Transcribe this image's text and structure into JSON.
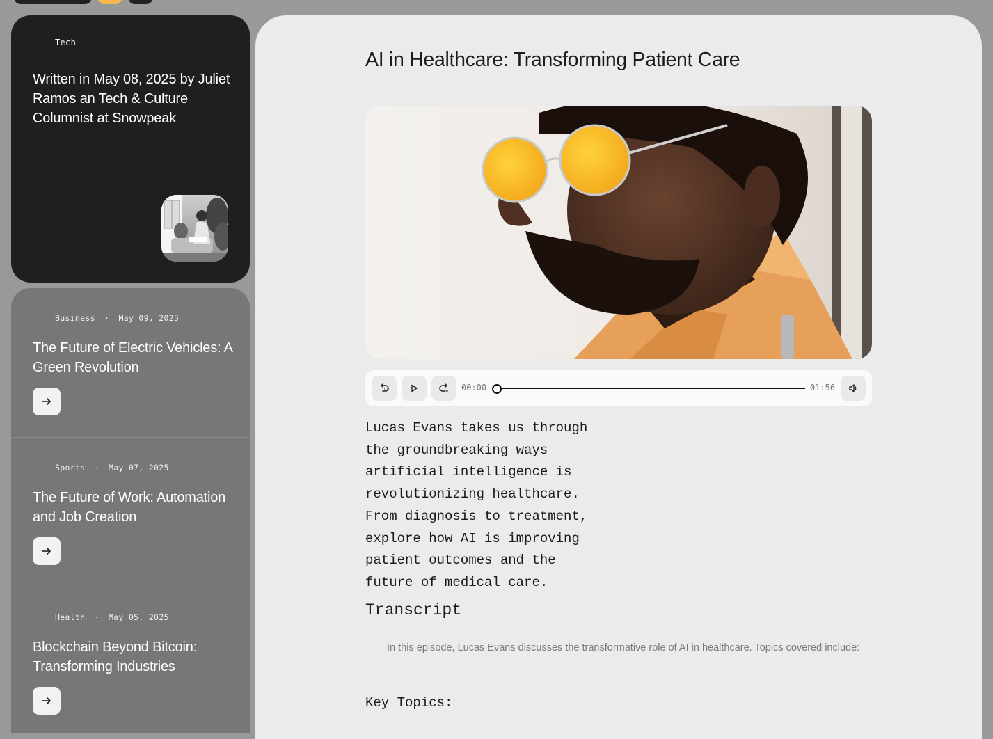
{
  "featured": {
    "tag": "Tech",
    "headline": "Written in May 08, 2025 by Juliet Ramos an Tech & Culture Columnist at Snowpeak",
    "thumbnail_icon": "woman-reading-photo"
  },
  "articles": [
    {
      "category": "Business",
      "separator": "·",
      "date": "May 09, 2025",
      "title": "The Future of Electric Vehicles: A Green Revolution",
      "button_icon": "arrow-right-icon"
    },
    {
      "category": "Sports",
      "separator": "·",
      "date": "May 07, 2025",
      "title": "The Future of Work: Automation and Job Creation",
      "button_icon": "arrow-right-icon"
    },
    {
      "category": "Health",
      "separator": "·",
      "date": "May 05, 2025",
      "title": "Blockchain Beyond Bitcoin: Transforming Industries",
      "button_icon": "arrow-right-icon"
    }
  ],
  "main": {
    "title": "AI in Healthcare: Transforming Patient Care",
    "hero_icon": "man-in-yellow-sunglasses-photo",
    "player": {
      "current_time": "00:00",
      "duration": "01:56",
      "progress": 0,
      "icons": [
        "rewind-10-icon",
        "play-icon",
        "forward-10-icon",
        "volume-icon"
      ]
    },
    "description": "Lucas Evans takes us through the groundbreaking ways artificial intelligence is revolutionizing healthcare. From diagnosis to treatment, explore how AI is improving patient outcomes and the future of medical care.",
    "transcript_heading": "Transcript",
    "transcript_text": "In this episode, Lucas Evans discusses the transformative role of AI in healthcare. Topics covered include:",
    "key_topics_heading": "Key Topics:"
  },
  "colors": {
    "background": "#999999",
    "featured_card": "#1f1f1f",
    "article_panel": "#777777",
    "main_panel": "#ebebeb",
    "accent": "#f5b74e"
  }
}
